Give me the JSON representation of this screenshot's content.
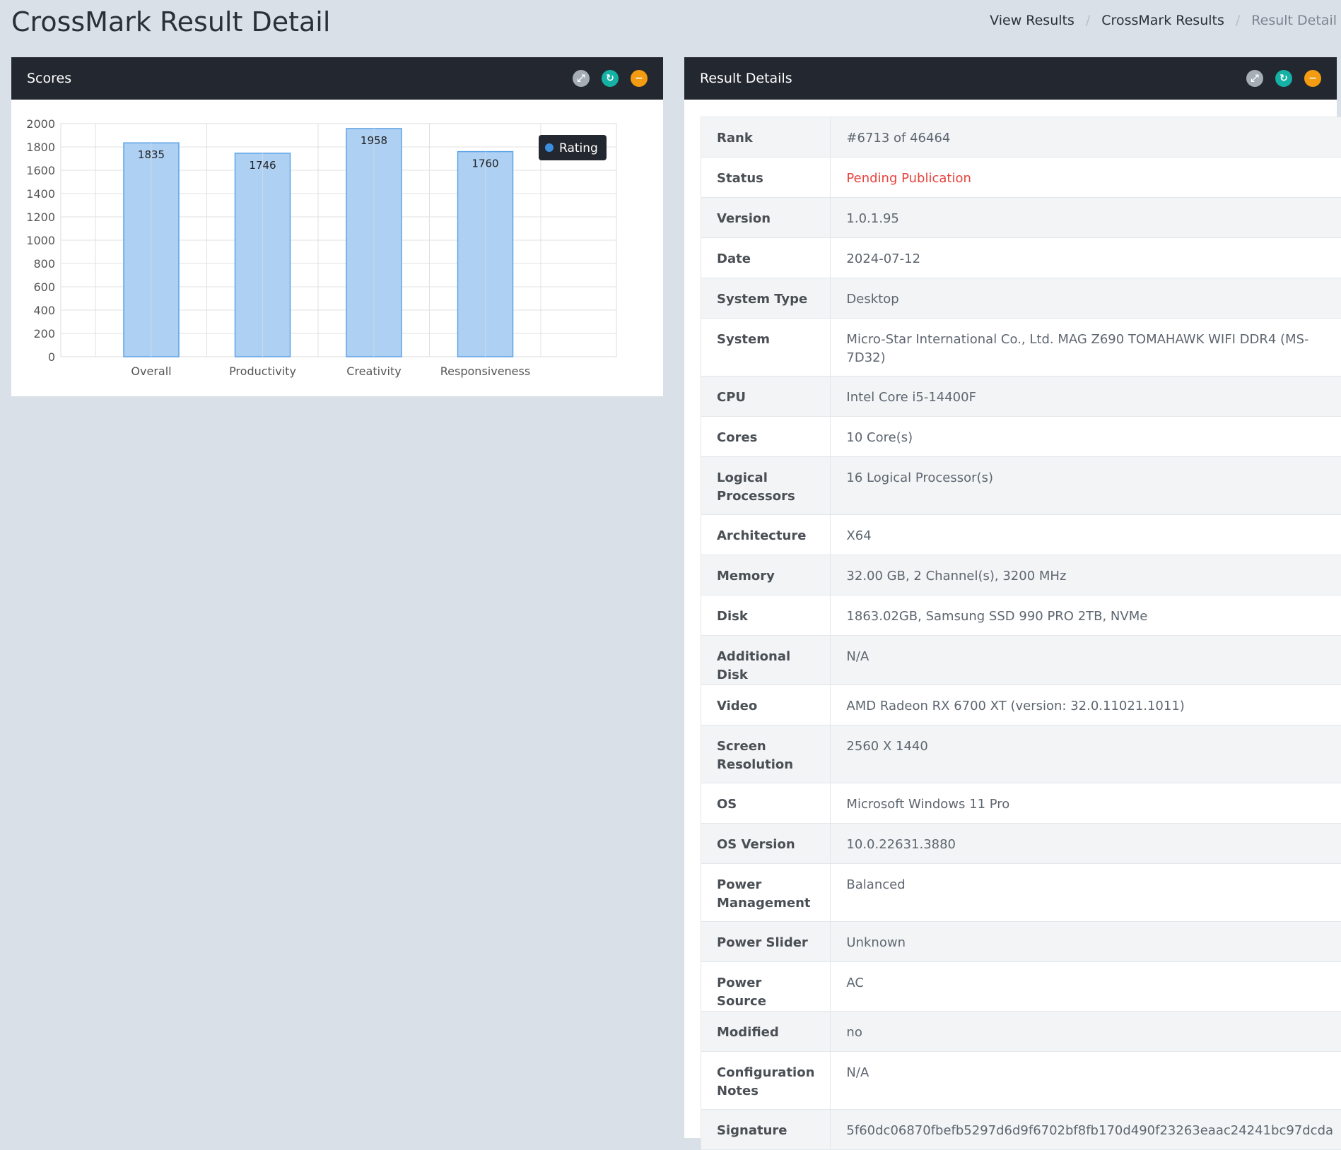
{
  "page": {
    "title": "CrossMark Result Detail",
    "breadcrumb": [
      {
        "label": "View Results"
      },
      {
        "label": "CrossMark Results"
      },
      {
        "label": "Result Detail"
      }
    ]
  },
  "scores_panel": {
    "title": "Scores"
  },
  "details_panel": {
    "title": "Result Details"
  },
  "colors": {
    "bar_fill": "#aed0f3",
    "bar_stroke": "#5ea4e6",
    "legend_dot": "#3b8ee0",
    "status_red": "#e8433d"
  },
  "chart_data": {
    "type": "bar",
    "categories": [
      "Overall",
      "Productivity",
      "Creativity",
      "Responsiveness"
    ],
    "series": [
      {
        "name": "Rating",
        "values": [
          1835,
          1746,
          1958,
          1760
        ]
      }
    ],
    "ylim": [
      0,
      2000
    ],
    "yticks": [
      0,
      200,
      400,
      600,
      800,
      1000,
      1200,
      1400,
      1600,
      1800,
      2000
    ],
    "grid": true,
    "legend": "top-right",
    "data_labels": true
  },
  "details": [
    {
      "key": "Rank",
      "value": "#6713 of 46464"
    },
    {
      "key": "Status",
      "value": "Pending Publication"
    },
    {
      "key": "Version",
      "value": "1.0.1.95"
    },
    {
      "key": "Date",
      "value": "2024-07-12"
    },
    {
      "key": "System Type",
      "value": "Desktop"
    },
    {
      "key": "System",
      "value": "Micro-Star International Co., Ltd. MAG Z690 TOMAHAWK WIFI DDR4 (MS-7D32)"
    },
    {
      "key": "CPU",
      "value": "Intel Core i5-14400F"
    },
    {
      "key": "Cores",
      "value": "10 Core(s)"
    },
    {
      "key": "Logical Processors",
      "value": "16 Logical Processor(s)"
    },
    {
      "key": "Architecture",
      "value": "X64"
    },
    {
      "key": "Memory",
      "value": "32.00 GB, 2 Channel(s), 3200 MHz"
    },
    {
      "key": "Disk",
      "value": "1863.02GB, Samsung SSD 990 PRO 2TB, NVMe"
    },
    {
      "key": "Additional Disk",
      "value": "N/A"
    },
    {
      "key": "Video",
      "value": "AMD Radeon RX 6700 XT (version: 32.0.11021.1011)"
    },
    {
      "key": "Screen Resolution",
      "value": "2560 X 1440"
    },
    {
      "key": "OS",
      "value": "Microsoft Windows 11 Pro"
    },
    {
      "key": "OS Version",
      "value": "10.0.22631.3880"
    },
    {
      "key": "Power Management",
      "value": "Balanced"
    },
    {
      "key": "Power Slider",
      "value": "Unknown"
    },
    {
      "key": "Power Source",
      "value": "AC"
    },
    {
      "key": "Modified",
      "value": "no"
    },
    {
      "key": "Configuration Notes",
      "value": "N/A"
    },
    {
      "key": "Signature",
      "value": "5f60dc06870fbefb5297d6d9f6702bf8fb170d490f23263eaac24241bc97dcda"
    }
  ]
}
